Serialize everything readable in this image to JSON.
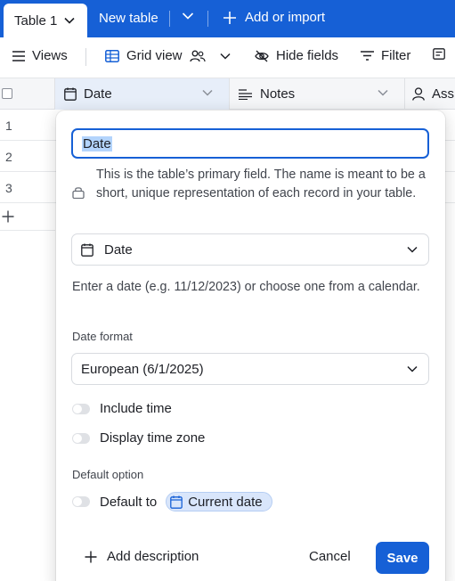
{
  "tabs": {
    "active_label": "Table 1",
    "new_label": "New table",
    "add_import_label": "Add or import"
  },
  "toolbar": {
    "views_label": "Views",
    "grid_view_label": "Grid view",
    "hide_fields_label": "Hide fields",
    "filter_label": "Filter"
  },
  "grid": {
    "columns": [
      "Date",
      "Notes",
      "Assi"
    ],
    "rows": [
      "1",
      "2",
      "3"
    ]
  },
  "field_editor": {
    "name_value": "Date",
    "primary_note": "This is the table’s primary field. The name is meant to be a short, unique representation of each record in your table.",
    "field_type": "Date",
    "type_description": "Enter a date (e.g. 11/12/2023) or choose one from a calendar.",
    "date_format_label": "Date format",
    "date_format_value": "European (6/1/2025)",
    "include_time_label": "Include time",
    "display_timezone_label": "Display time zone",
    "default_option_label": "Default option",
    "default_to_label": "Default to",
    "default_value": "Current date",
    "add_description_label": "Add description",
    "cancel_label": "Cancel",
    "save_label": "Save"
  },
  "colors": {
    "brand_blue": "#1660d6",
    "selected_header": "#e7eef9",
    "chip_bg": "#d9e6fb"
  },
  "icons": [
    "chevron-down-icon",
    "plus-icon",
    "menu-icon",
    "grid-icon",
    "people-icon",
    "eye-off-icon",
    "filter-icon",
    "calendar-icon",
    "text-lines-icon",
    "person-icon",
    "lock-icon"
  ]
}
